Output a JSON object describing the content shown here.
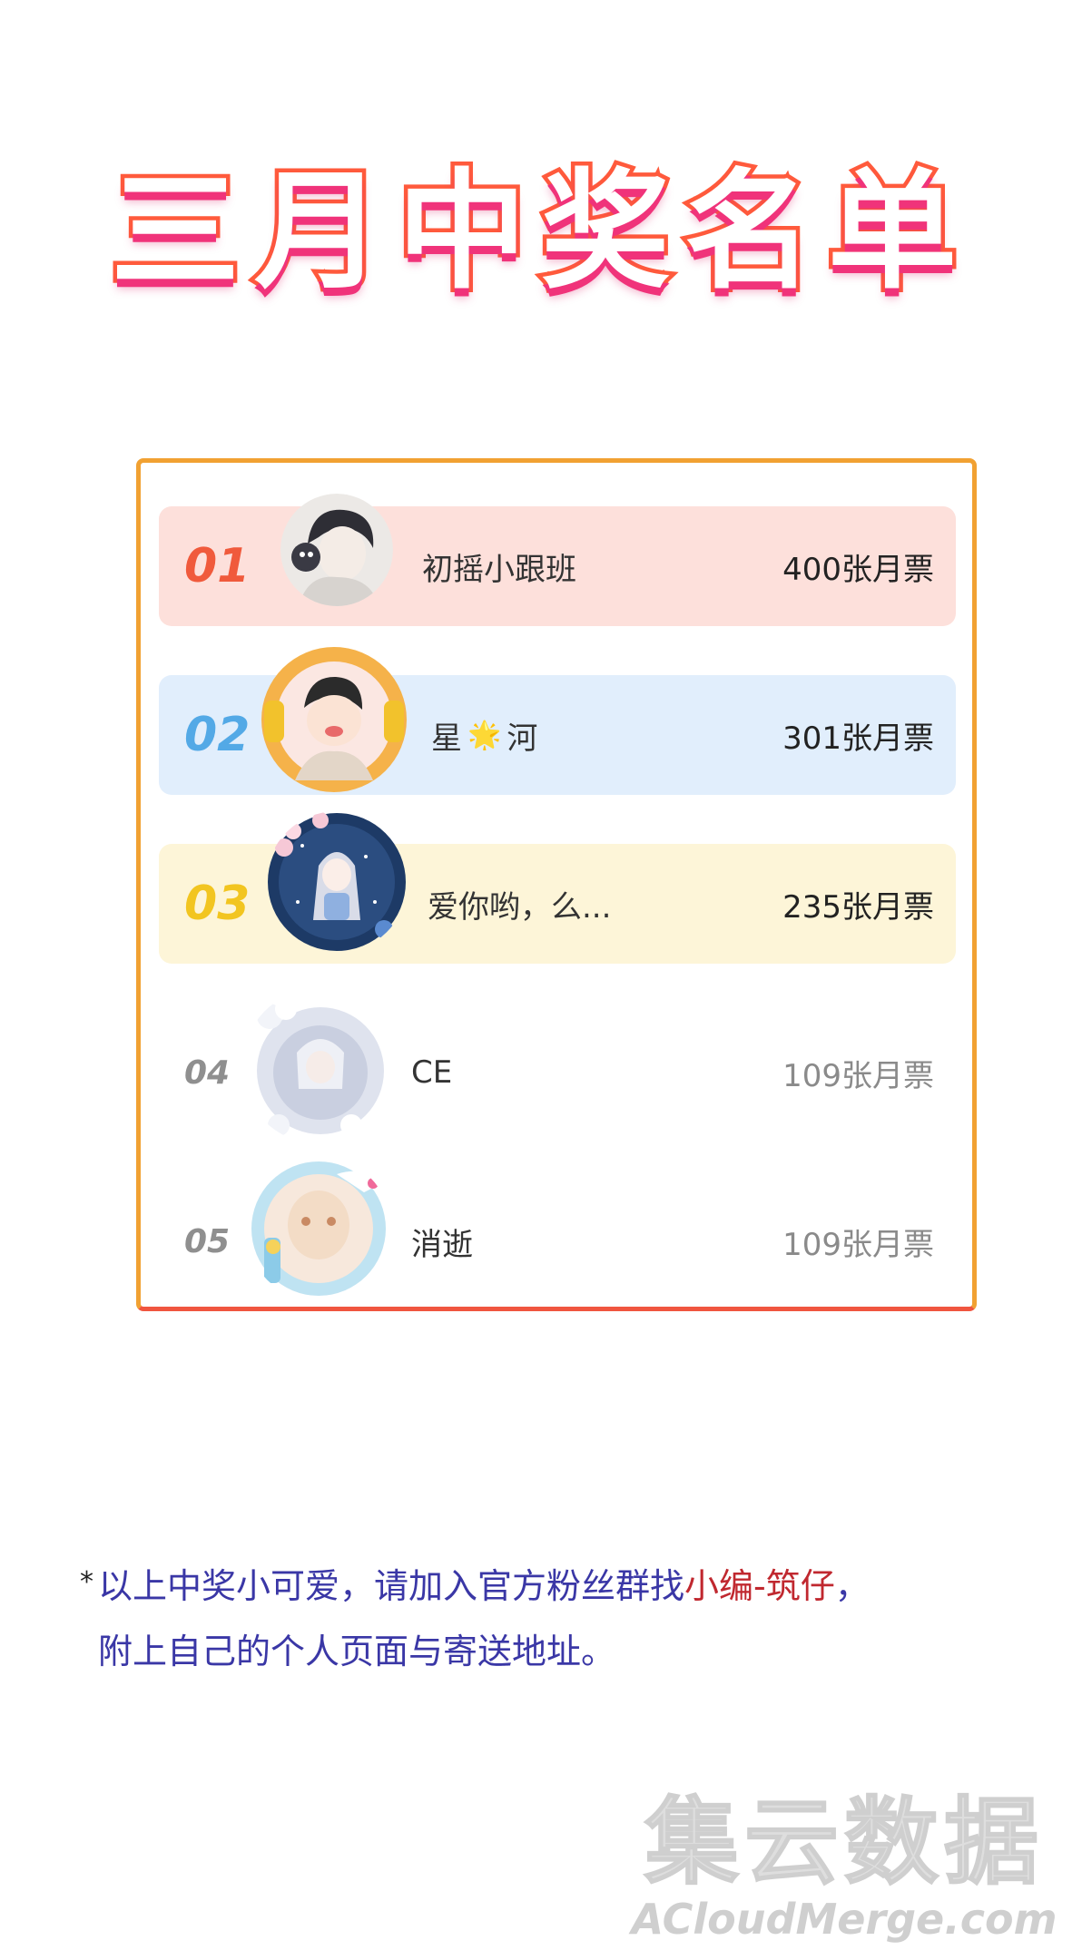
{
  "title": "三月中奖名单",
  "entries": [
    {
      "rank": "01",
      "name": "初摇小跟班",
      "votes": "400张月票",
      "color": "#f05a3c",
      "bg": "#fde0db"
    },
    {
      "rank": "02",
      "name": "星",
      "emoji": "🌟",
      "name2": "河",
      "votes": "301张月票",
      "color": "#53a9e6",
      "bg": "#e1eefc"
    },
    {
      "rank": "03",
      "name": "爱你哟，么...",
      "votes": "235张月票",
      "color": "#f2c520",
      "bg": "#fdf5d8"
    },
    {
      "rank": "04",
      "name": "CE",
      "votes": "109张月票"
    },
    {
      "rank": "05",
      "name": "消逝",
      "votes": "109张月票"
    }
  ],
  "note": {
    "star": "*",
    "part1": "以上中奖小可爱，请加入官方粉丝群找",
    "highlight": "小编-筑仔",
    "part2": "，",
    "line2": "附上自己的个人页面与寄送地址。"
  },
  "watermark": {
    "cn": "集云数据",
    "en": "ACloudMerge.com"
  }
}
